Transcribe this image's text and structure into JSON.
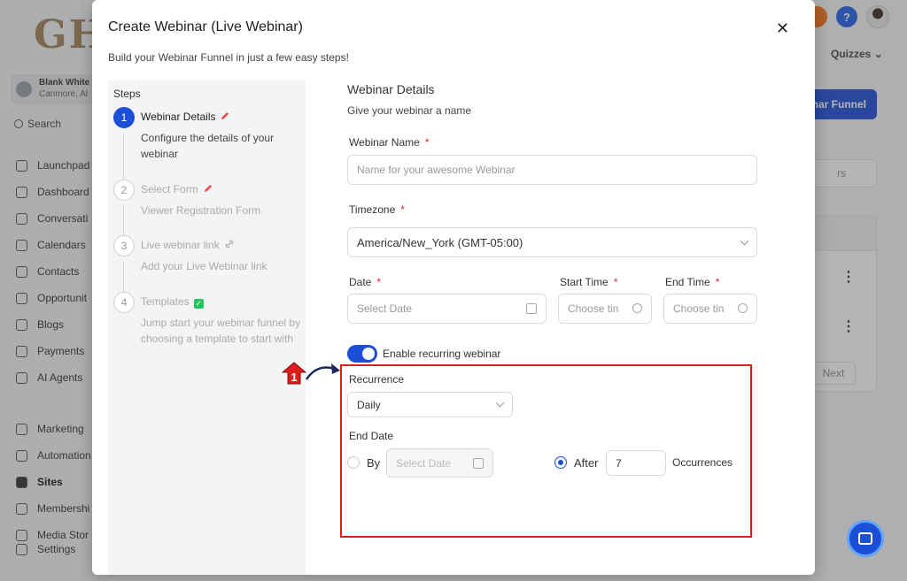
{
  "background": {
    "logo": "GH",
    "account": {
      "name": "Blank White",
      "location": "Canmore, Al"
    },
    "search_label": "Search",
    "nav": [
      {
        "label": "Launchpad",
        "icon": "rocket-icon"
      },
      {
        "label": "Dashboard",
        "icon": "grid-icon"
      },
      {
        "label": "Conversati",
        "icon": "chat-icon"
      },
      {
        "label": "Calendars",
        "icon": "calendar-icon"
      },
      {
        "label": "Contacts",
        "icon": "contacts-icon"
      },
      {
        "label": "Opportunit",
        "icon": "pipeline-icon"
      },
      {
        "label": "Blogs",
        "icon": "blog-icon"
      },
      {
        "label": "Payments",
        "icon": "payments-icon"
      },
      {
        "label": "AI Agents",
        "icon": "sparkle-icon"
      },
      {
        "label": "Marketing",
        "icon": "megaphone-icon"
      },
      {
        "label": "Automation",
        "icon": "automation-icon"
      },
      {
        "label": "Sites",
        "icon": "sites-icon",
        "active": true
      },
      {
        "label": "Membershi",
        "icon": "membership-icon"
      },
      {
        "label": "Media Stor",
        "icon": "media-icon"
      },
      {
        "label": "Settings",
        "icon": "gear-icon"
      }
    ],
    "help_label": "?",
    "quizzes_label": "Quizzes",
    "funnel_button": "nar Funnel",
    "search_fragment": "rs",
    "next_label": "Next"
  },
  "modal": {
    "title": "Create Webinar (Live Webinar)",
    "subtitle": "Build your Webinar Funnel in just a few easy steps!",
    "steps_label": "Steps",
    "steps": [
      {
        "num": "1",
        "title": "Webinar Details",
        "desc": "Configure the details of your webinar",
        "mark": "pencil"
      },
      {
        "num": "2",
        "title": "Select Form",
        "desc": "Viewer Registration Form",
        "mark": "pencil"
      },
      {
        "num": "3",
        "title": "Live webinar link",
        "desc": "Add your Live Webinar link",
        "mark": "link"
      },
      {
        "num": "4",
        "title": "Templates",
        "desc": "Jump start your webinar funnel by choosing a template to start with",
        "mark": "check"
      }
    ],
    "form": {
      "section_title": "Webinar Details",
      "section_subtitle": "Give your webinar a name",
      "name_label": "Webinar Name",
      "name_placeholder": "Name for your awesome Webinar",
      "timezone_label": "Timezone",
      "timezone_value": "America/New_York (GMT-05:00)",
      "date_label": "Date",
      "date_placeholder": "Select Date",
      "start_time_label": "Start Time",
      "start_time_placeholder": "Choose tin",
      "end_time_label": "End Time",
      "end_time_placeholder": "Choose tin",
      "required_mark": "*",
      "recurring_toggle_label": "Enable recurring webinar",
      "recurring_enabled": true,
      "recurrence_label": "Recurrence",
      "recurrence_value": "Daily",
      "end_date_label": "End Date",
      "end_by_label": "By",
      "end_by_placeholder": "Select Date",
      "end_after_label": "After",
      "end_after_value": "7",
      "occurrences_label": "Occurrences",
      "selected_end_option": "After"
    }
  },
  "annotation": {
    "callout_number": "1",
    "highlight_color": "#e01e1e"
  },
  "colors": {
    "primary": "#1d4ed8",
    "required": "#e02424",
    "success": "#22c55e"
  }
}
